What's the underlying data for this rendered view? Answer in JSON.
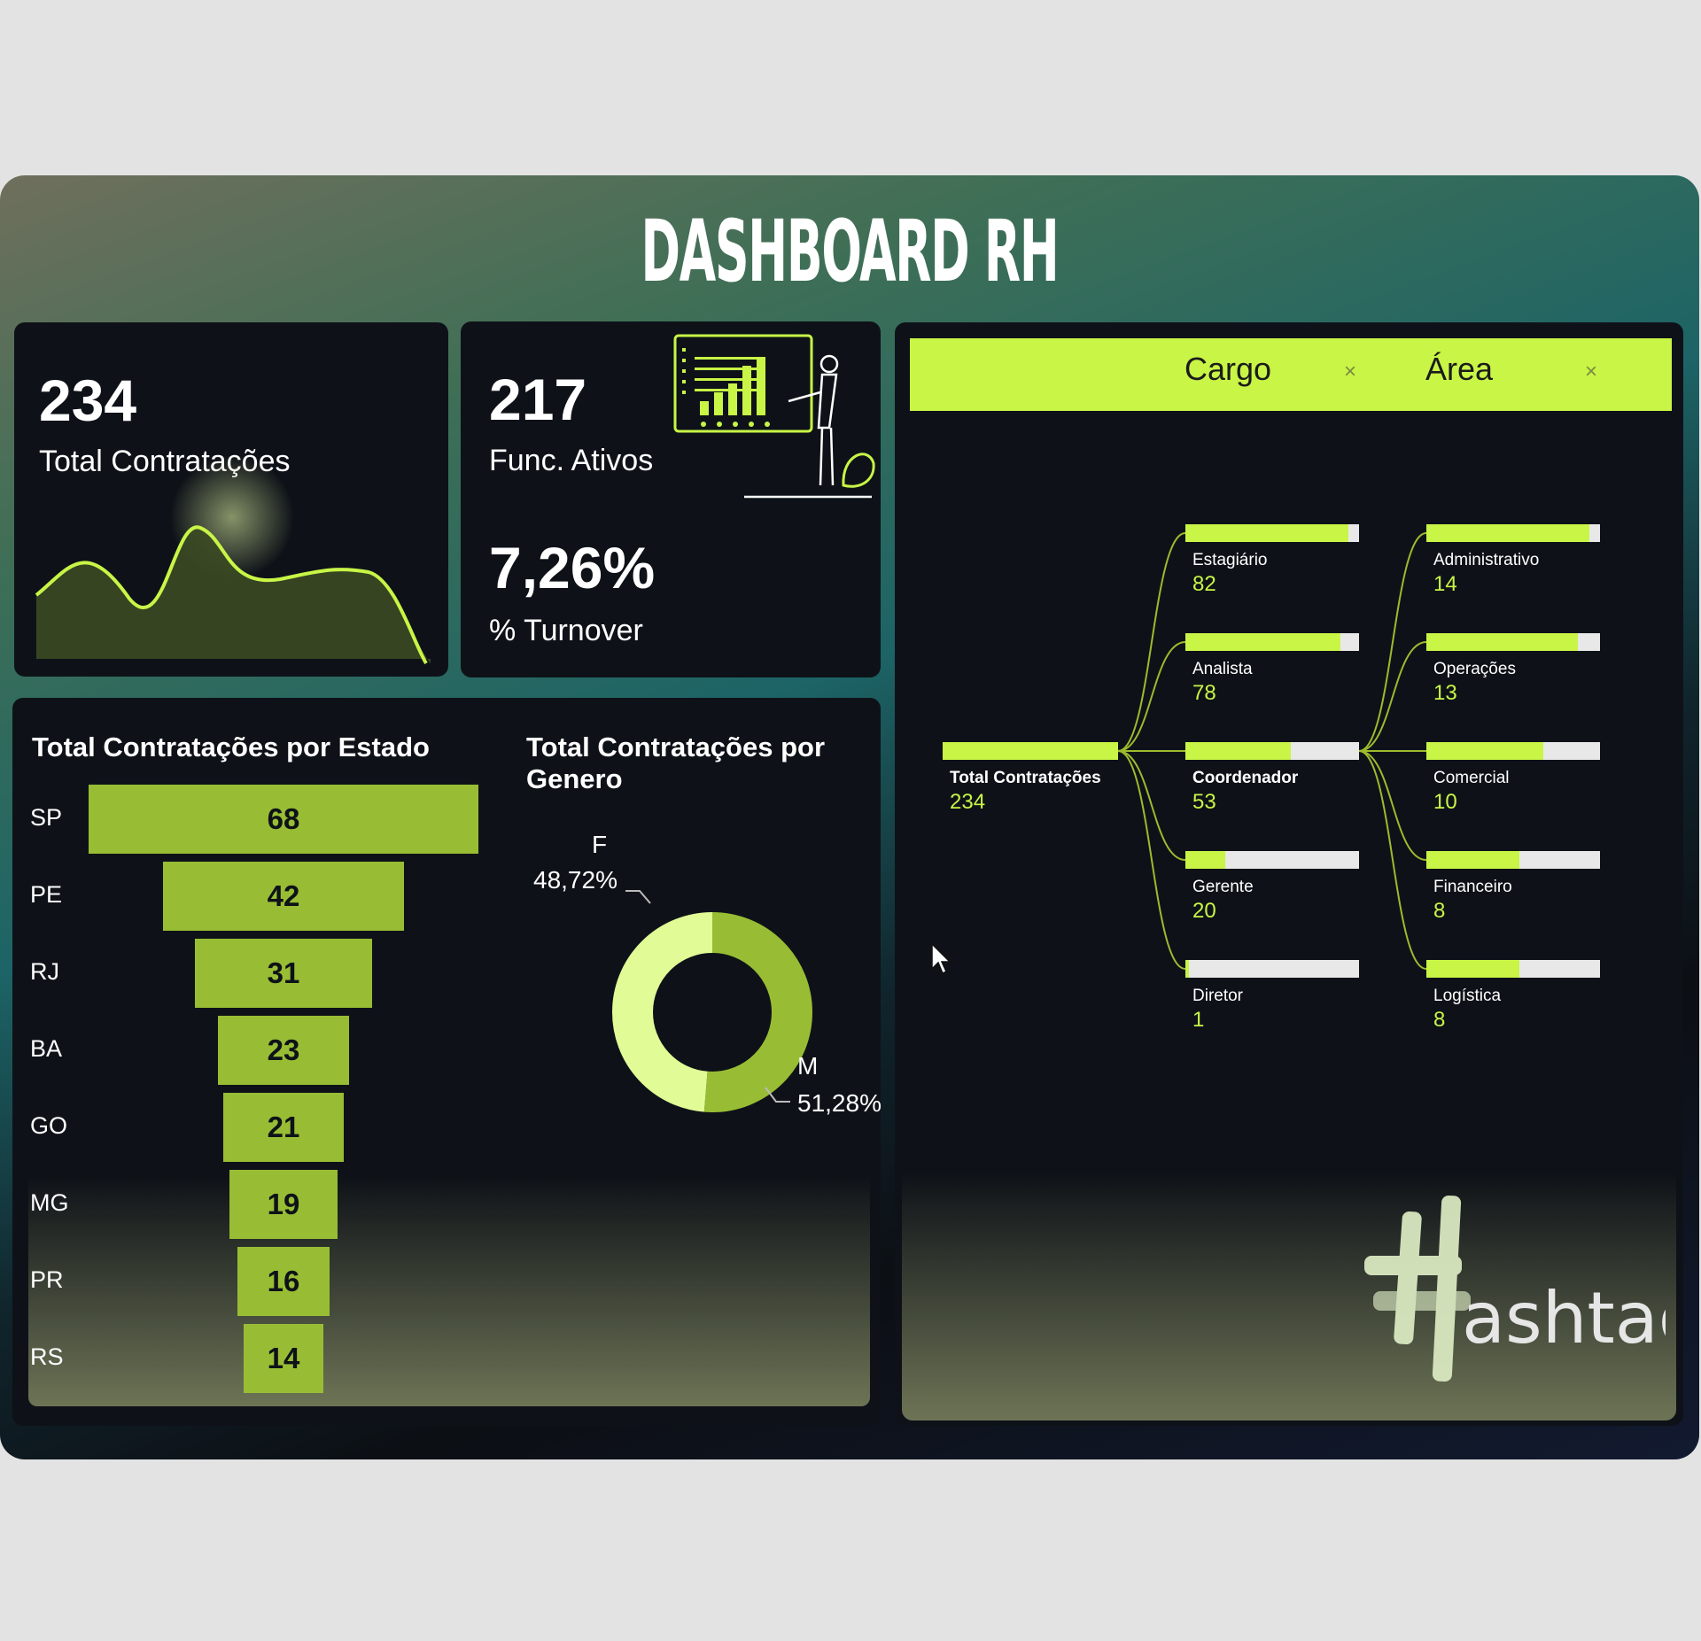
{
  "title": "DASHBOARD RH",
  "kpi_total": {
    "value": "234",
    "label": "Total Contratações"
  },
  "kpi_ativos": {
    "value": "217",
    "label": "Func. Ativos"
  },
  "kpi_turnover": {
    "value": "7,26%",
    "label": "% Turnover"
  },
  "funnel": {
    "title": "Total Contratações por Estado",
    "items": [
      {
        "label": "SP",
        "value": "68"
      },
      {
        "label": "PE",
        "value": "42"
      },
      {
        "label": "RJ",
        "value": "31"
      },
      {
        "label": "BA",
        "value": "23"
      },
      {
        "label": "GO",
        "value": "21"
      },
      {
        "label": "MG",
        "value": "19"
      },
      {
        "label": "PR",
        "value": "16"
      },
      {
        "label": "RS",
        "value": "14"
      }
    ]
  },
  "donut": {
    "title": "Total Contratações por Genero",
    "f_label": "F",
    "f_pct": "48,72%",
    "m_label": "M",
    "m_pct": "51,28%"
  },
  "decomp": {
    "tabs": [
      {
        "label": "Cargo",
        "close": "×"
      },
      {
        "label": "Área",
        "close": "×"
      }
    ],
    "root": {
      "name": "Total Contratações",
      "value": "234"
    },
    "cargo": [
      {
        "name": "Estagiário",
        "value": "82"
      },
      {
        "name": "Analista",
        "value": "78"
      },
      {
        "name": "Coordenador",
        "value": "53"
      },
      {
        "name": "Gerente",
        "value": "20"
      },
      {
        "name": "Diretor",
        "value": "1"
      }
    ],
    "area": [
      {
        "name": "Administrativo",
        "value": "14"
      },
      {
        "name": "Operações",
        "value": "13"
      },
      {
        "name": "Comercial",
        "value": "10"
      },
      {
        "name": "Financeiro",
        "value": "8"
      },
      {
        "name": "Logística",
        "value": "8"
      }
    ]
  },
  "logo": {
    "text": "ashtag"
  },
  "colors": {
    "accent": "#c8f546",
    "bar": "#98bd34",
    "card": "#0e1218"
  },
  "chart_data": [
    {
      "type": "bar",
      "title": "Total Contratações por Estado",
      "categories": [
        "SP",
        "PE",
        "RJ",
        "BA",
        "GO",
        "MG",
        "PR",
        "RS"
      ],
      "values": [
        68,
        42,
        31,
        23,
        21,
        19,
        16,
        14
      ]
    },
    {
      "type": "pie",
      "title": "Total Contratações por Genero",
      "categories": [
        "F",
        "M"
      ],
      "values": [
        48.72,
        51.28
      ]
    },
    {
      "type": "line",
      "title": "Total Contratações",
      "trend": "sparkline"
    }
  ]
}
